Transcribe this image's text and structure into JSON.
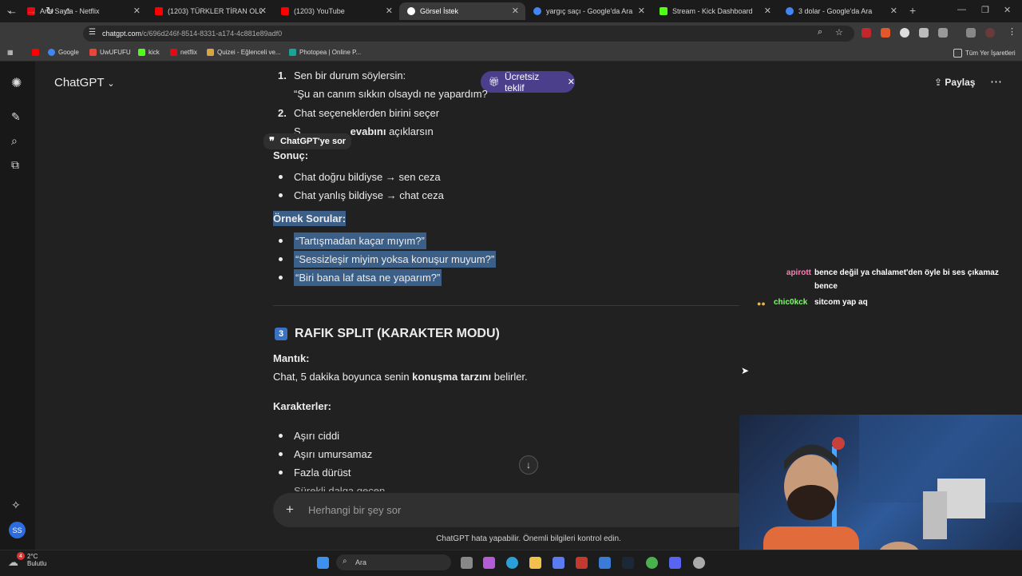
{
  "browser": {
    "tabs": [
      {
        "title": "Ana Sayfa - Netflix",
        "icon": "netflix-icon",
        "color": "#e50914"
      },
      {
        "title": "(1203) TÜRKLER TİRAN OLUYOR",
        "icon": "youtube-icon",
        "color": "#ff0000"
      },
      {
        "title": "(1203) YouTube",
        "icon": "youtube-icon",
        "color": "#ff0000"
      },
      {
        "title": "Görsel İstek",
        "icon": "chatgpt-icon",
        "color": "#ffffff"
      },
      {
        "title": "yargıç saçı - Google'da Ara",
        "icon": "google-icon",
        "color": "#4285f4"
      },
      {
        "title": "Stream - Kick Dashboard",
        "icon": "kick-icon",
        "color": "#53fc18"
      },
      {
        "title": "3 dolar - Google'da Ara",
        "icon": "google-icon",
        "color": "#4285f4"
      }
    ],
    "url_host": "chatgpt.com",
    "url_path": "/c/696d246f-8514-8331-a174-4c881e89adf0",
    "bookmarks": [
      {
        "label": "",
        "icon": "youtube-icon",
        "color": "#ff0000"
      },
      {
        "label": "Google",
        "icon": "google-icon",
        "color": "#4285f4"
      },
      {
        "label": "UwUFUFU",
        "icon": "uwufufu-icon",
        "color": "#e8453c"
      },
      {
        "label": "kick",
        "icon": "kick-icon",
        "color": "#53fc18"
      },
      {
        "label": "netflix",
        "icon": "netflix-icon",
        "color": "#e50914"
      },
      {
        "label": "Quizei - Eğlenceli ve...",
        "icon": "quizei-icon",
        "color": "#d9a441"
      },
      {
        "label": "Photopea | Online P...",
        "icon": "photopea-icon",
        "color": "#18a497"
      }
    ],
    "all_bookmarks": "Tüm Yer İşaretleri"
  },
  "app": {
    "model": "ChatGPT",
    "offer": "Ücretsiz teklif",
    "share": "Paylaş",
    "ask_tooltip": "ChatGPT'ye sor",
    "composer_placeholder": "Herhangi bir şey sor",
    "disclaimer": "ChatGPT hata yapabilir. Önemli bilgileri kontrol edin.",
    "avatar": "SS"
  },
  "content": {
    "step1_num": "1.",
    "step1": "Sen bir durum söylersin:",
    "step1_quote": "“Şu an canım sıkkın olsaydı ne yapardım?",
    "step2_num": "2.",
    "step2": "Chat seçeneklerden birini seçer",
    "step3_partial_a": "S",
    "step3_partial_b": "evabını",
    "step3_partial_c": " açıklarsın",
    "result_label": "Sonuç:",
    "result_items": [
      "Chat doğru bildiyse → sen ceza",
      "Chat yanlış bildiyse → chat ceza"
    ],
    "examples_label": "Örnek Sorular:",
    "examples": [
      "“Tartışmadan kaçar mıyım?”",
      "“Sessizleşir miyim yoksa konuşur muyum?”",
      "“Biri bana laf atsa ne yaparım?”"
    ],
    "section3_badge": "3",
    "section3_title": "RAFIK SPLIT (KARAKTER MODU)",
    "logic_label": "Mantık:",
    "logic_pre": "Chat, 5 dakika boyunca senin ",
    "logic_bold": "konuşma tarzını",
    "logic_post": " belirler.",
    "characters_label": "Karakterler:",
    "characters": [
      "Aşırı ciddi",
      "Aşırı umursamaz",
      "Fazla dürüst"
    ],
    "characters_partial": "Sürekli dalga geçen"
  },
  "stream_chat": [
    {
      "user": "apirott",
      "color": "#ff7eb6",
      "message_line1": "bence değil ya chalamet'den öyle bi ses çıkamaz",
      "message_line2": "bence"
    },
    {
      "user": "chic0kck",
      "color": "#7dff6a",
      "message_line1": "sitcom yap aq",
      "message_line2": ""
    }
  ],
  "taskbar": {
    "weather_temp": "2°C",
    "weather_desc": "Bulutlu",
    "weather_alert": "4",
    "search_placeholder": "Ara"
  }
}
